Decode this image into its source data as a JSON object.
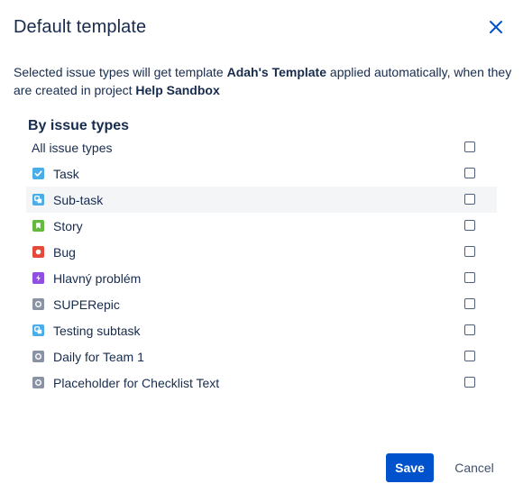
{
  "dialog": {
    "title": "Default template",
    "description_part1": "Selected issue types will get template ",
    "template_name": "Adah's Template",
    "description_part2": " applied automatically, when they are created in project ",
    "project_name": "Help Sandbox"
  },
  "section": {
    "heading": "By issue types"
  },
  "issue_types": [
    {
      "label": "All issue types",
      "icon": "none",
      "color": "",
      "checked": false
    },
    {
      "label": "Task",
      "icon": "task-icon",
      "color": "#4bade8",
      "checked": false
    },
    {
      "label": "Sub-task",
      "icon": "subtask-icon",
      "color": "#4bade8",
      "checked": false,
      "hovered": true
    },
    {
      "label": "Story",
      "icon": "story-icon",
      "color": "#63ba3c",
      "checked": false
    },
    {
      "label": "Bug",
      "icon": "bug-icon",
      "color": "#e5493a",
      "checked": false
    },
    {
      "label": "Hlavný problém",
      "icon": "epic-icon",
      "color": "#904ee2",
      "checked": false
    },
    {
      "label": "SUPERepic",
      "icon": "generic-issue-icon",
      "color": "#8993a4",
      "checked": false
    },
    {
      "label": "Testing subtask",
      "icon": "subtask-icon",
      "color": "#4bade8",
      "checked": false
    },
    {
      "label": "Daily for Team 1",
      "icon": "generic-issue-icon",
      "color": "#8993a4",
      "checked": false
    },
    {
      "label": "Placeholder for Checklist Text",
      "icon": "generic-issue-icon",
      "color": "#8993a4",
      "checked": false
    }
  ],
  "footer": {
    "save_label": "Save",
    "cancel_label": "Cancel"
  },
  "colors": {
    "primary": "#0052cc",
    "text": "#172b4d",
    "hover_row": "#f4f5f7"
  }
}
